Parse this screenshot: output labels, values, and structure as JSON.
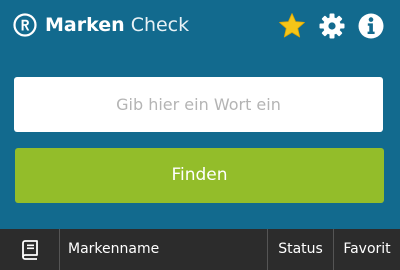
{
  "header": {
    "logo_icon": "registered-trademark-icon",
    "brand_bold": "Marken",
    "brand_light": "Check",
    "icons": [
      "star-icon",
      "gear-icon",
      "info-icon"
    ],
    "star_color": "#f5c518"
  },
  "search": {
    "placeholder": "Gib hier ein Wort ein",
    "value": ""
  },
  "find_button": {
    "label": "Finden",
    "color": "#93bd2a"
  },
  "table": {
    "icon": "book-icon",
    "columns": [
      "Markenname",
      "Status",
      "Favorit"
    ]
  },
  "colors": {
    "background": "#126a8e",
    "table_header": "#2c2c2c"
  }
}
